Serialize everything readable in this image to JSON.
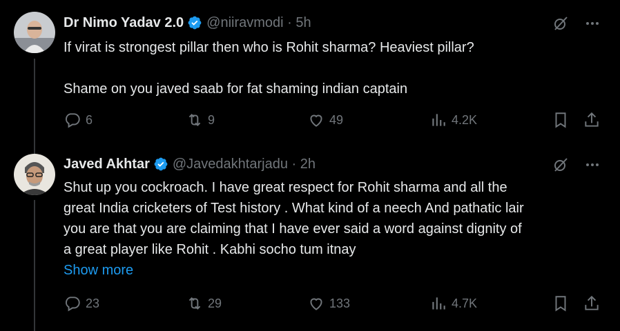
{
  "tweets": [
    {
      "name": "Dr Nimo Yadav 2.0",
      "handle": "@niiravmodi · 5h",
      "lines": [
        "If virat is strongest pillar then who is Rohit sharma? Heaviest pillar?",
        "",
        "Shame on you javed saab for fat shaming indian captain"
      ],
      "replies": "6",
      "reposts": "9",
      "likes": "49",
      "views": "4.2K"
    },
    {
      "name": "Javed Akhtar",
      "handle": "@Javedakhtarjadu · 2h",
      "lines": [
        "Shut up you cockroach. I have great respect for Rohit sharma and all the",
        "great India cricketers of Test history . What kind of a neech And pathatic lair",
        "you are that you are claiming that I have ever said a word against dignity of",
        "a great player like Rohit . Kabhi socho tum itnay"
      ],
      "show_more": "Show more",
      "replies": "23",
      "reposts": "29",
      "likes": "133",
      "views": "4.7K"
    }
  ],
  "colors": {
    "accent": "#1d9bf0",
    "muted": "#71767b",
    "text": "#e7e9ea",
    "background": "#000000"
  },
  "icons": [
    "verified-badge-icon",
    "grok-icon",
    "more-icon",
    "reply-icon",
    "repost-icon",
    "like-icon",
    "views-icon",
    "bookmark-icon",
    "share-icon"
  ]
}
